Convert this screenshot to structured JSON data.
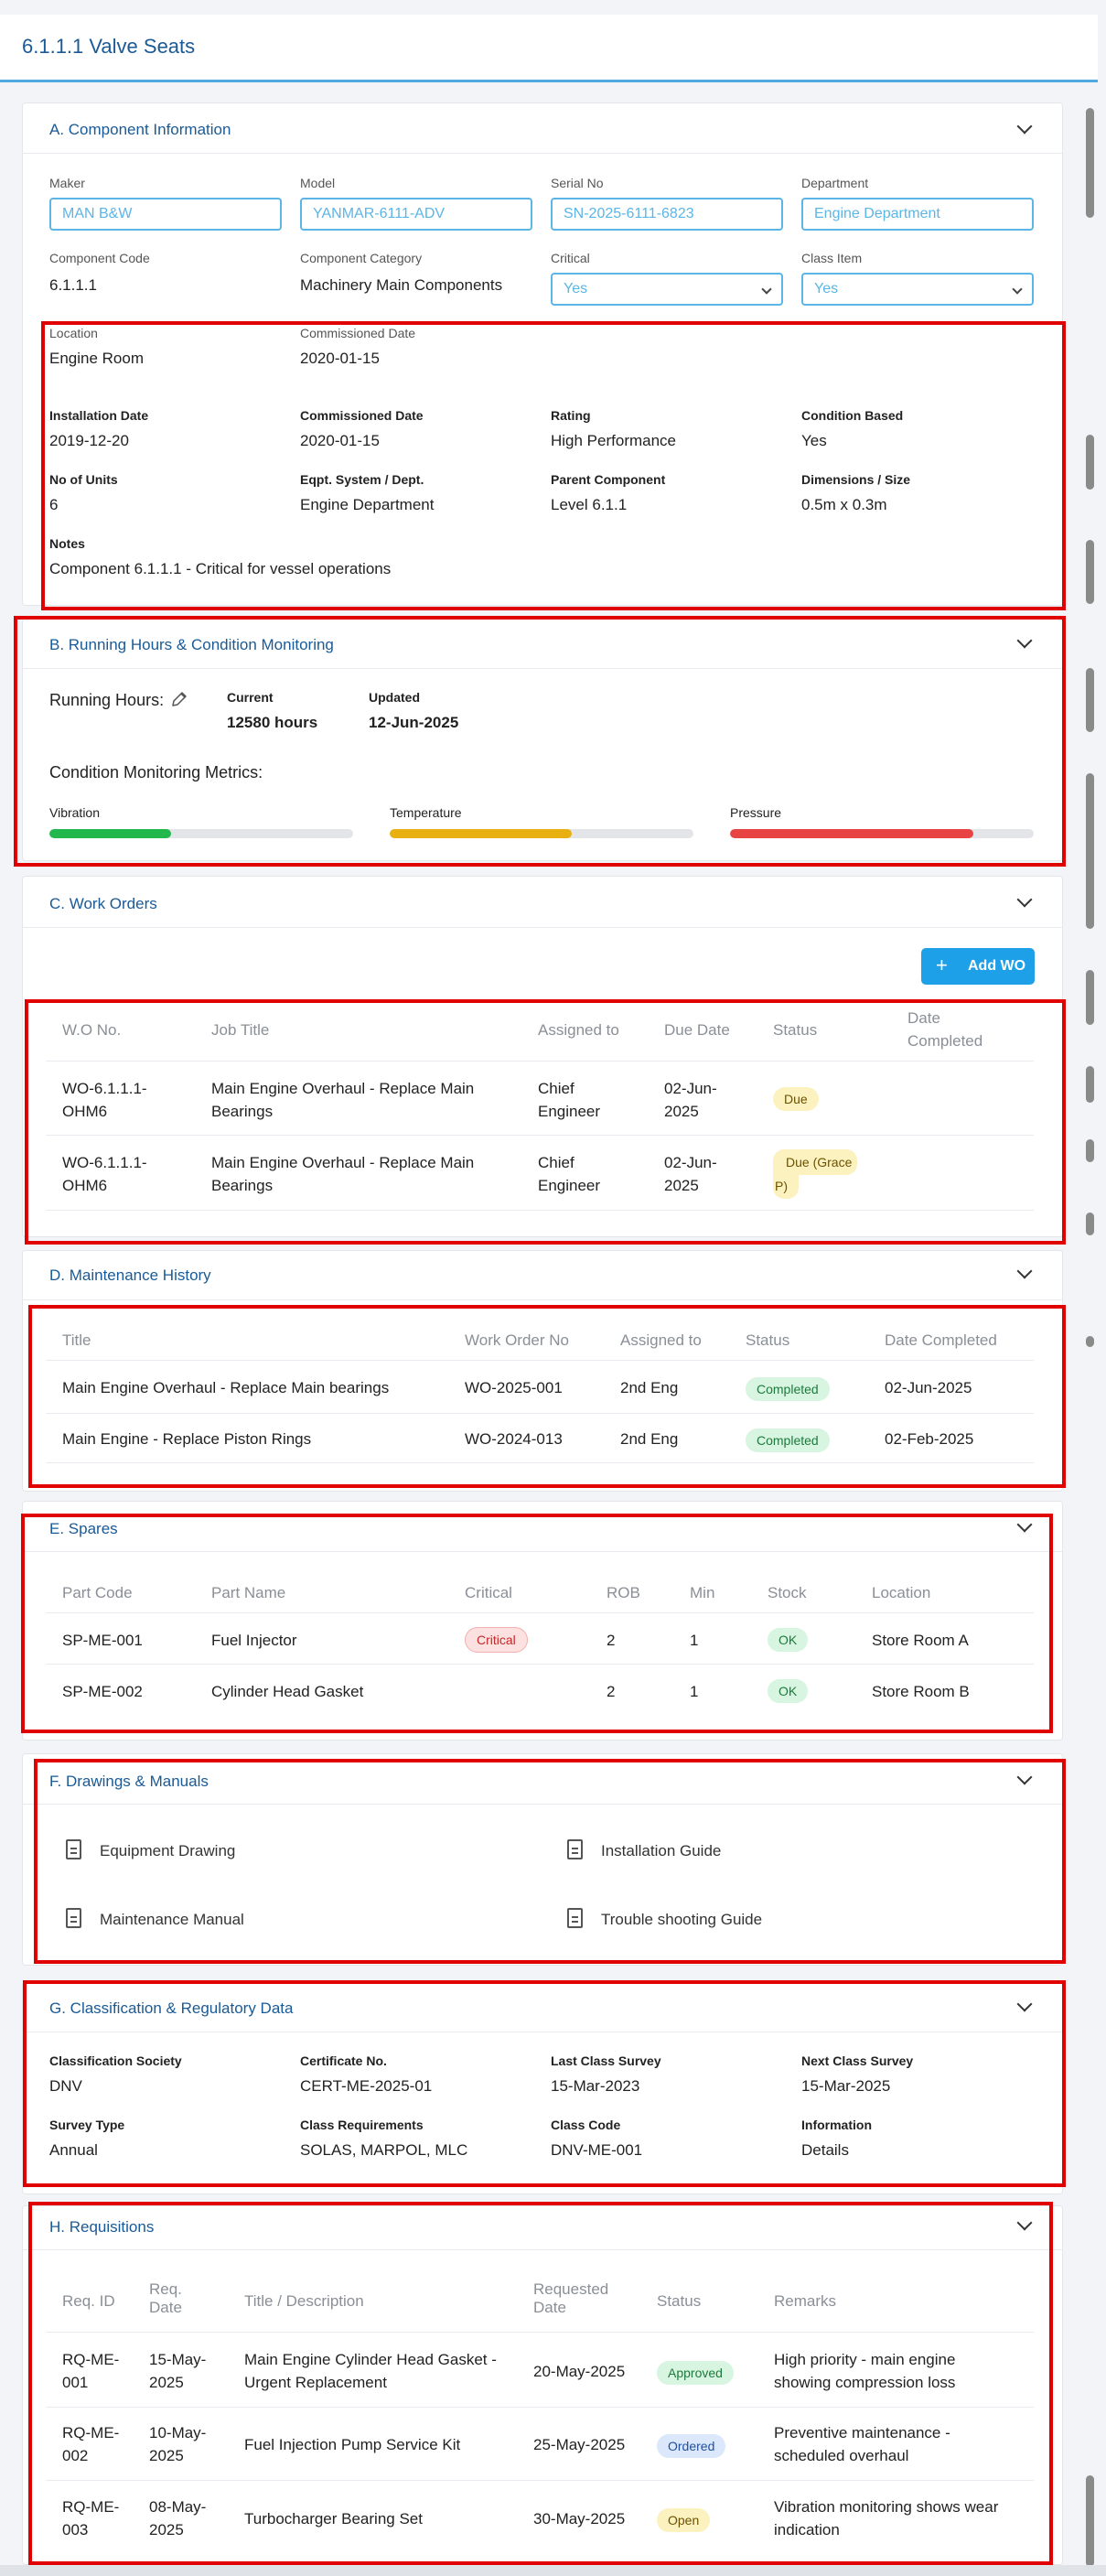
{
  "page_title": "6.1.1.1 Valve Seats",
  "sections": {
    "a": {
      "title": "A. Component Information",
      "maker_label": "Maker",
      "maker_value": "MAN B&W",
      "model_label": "Model",
      "model_value": "YANMAR-6111-ADV",
      "serial_label": "Serial No",
      "serial_value": "SN-2025-6111-6823",
      "dept_label": "Department",
      "dept_value": "Engine Department",
      "code_label": "Component Code",
      "code_value": "6.1.1.1",
      "category_label": "Component Category",
      "category_value": "Machinery Main Components",
      "critical_label": "Critical",
      "critical_value": "Yes",
      "class_label": "Class Item",
      "class_value": "Yes",
      "location_label": "Location",
      "location_value": "Engine Room",
      "commissioned_label": "Commissioned Date",
      "commissioned_value": "2020-01-15",
      "install_label": "Installation Date",
      "install_value": "2019-12-20",
      "commissioned2_label": "Commissioned Date",
      "commissioned2_value": "2020-01-15",
      "rating_label": "Rating",
      "rating_value": "High Performance",
      "condition_label": "Condition Based",
      "condition_value": "Yes",
      "units_label": "No of Units",
      "units_value": "6",
      "eqpt_label": "Eqpt. System / Dept.",
      "eqpt_value": "Engine Department",
      "parent_label": "Parent Component",
      "parent_value": "Level 6.1.1",
      "dims_label": "Dimensions / Size",
      "dims_value": "0.5m x 0.3m",
      "notes_label": "Notes",
      "notes_value": "Component 6.1.1.1 - Critical for vessel operations"
    },
    "b": {
      "title": "B. Running Hours & Condition Monitoring",
      "running_label": "Running Hours:",
      "current_label": "Current",
      "current_value": "12580 hours",
      "updated_label": "Updated",
      "updated_value": "12-Jun-2025",
      "metrics_label": "Condition Monitoring Metrics:",
      "metrics": [
        {
          "name": "Vibration",
          "level": 0.4,
          "color": "#22b84e"
        },
        {
          "name": "Temperature",
          "level": 0.6,
          "color": "#e8b010"
        },
        {
          "name": "Pressure",
          "level": 0.8,
          "color": "#e84444"
        }
      ]
    },
    "c": {
      "title": "C. Work Orders",
      "add_label": "Add WO",
      "headers": [
        "W.O No.",
        "Job Title",
        "Assigned to",
        "Due Date",
        "Status",
        "Date",
        "Completed"
      ],
      "rows": [
        {
          "wo1": "WO-6.1.1.1-",
          "wo2": "OHM6",
          "job1": "Main Engine Overhaul - Replace Main",
          "job2": "Bearings",
          "as1": "Chief",
          "as2": "Engineer",
          "due1": "02-Jun-",
          "due2": "2025",
          "status": "Due"
        },
        {
          "wo1": "WO-6.1.1.1-",
          "wo2": "OHM6",
          "job1": "Main Engine Overhaul - Replace Main",
          "job2": "Bearings",
          "as1": "Chief",
          "as2": "Engineer",
          "due1": "02-Jun-",
          "due2": "2025",
          "status1": "Due (Grace",
          "status2": "P)"
        }
      ]
    },
    "d": {
      "title": "D. Maintenance History",
      "headers": [
        "Title",
        "Work Order No",
        "Assigned to",
        "Status",
        "Date Completed"
      ],
      "rows": [
        {
          "title": "Main Engine Overhaul - Replace Main bearings",
          "wo": "WO-2025-001",
          "assigned": "2nd Eng",
          "status": "Completed",
          "date": "02-Jun-2025"
        },
        {
          "title": "Main Engine - Replace Piston Rings",
          "wo": "WO-2024-013",
          "assigned": "2nd Eng",
          "status": "Completed",
          "date": "02-Feb-2025"
        }
      ]
    },
    "e": {
      "title": "E. Spares",
      "headers": [
        "Part Code",
        "Part Name",
        "Critical",
        "ROB",
        "Min",
        "Stock",
        "Location"
      ],
      "rows": [
        {
          "code": "SP-ME-001",
          "name": "Fuel Injector",
          "critical": "Critical",
          "rob": "2",
          "min": "1",
          "stock": "OK",
          "location": "Store Room A"
        },
        {
          "code": "SP-ME-002",
          "name": "Cylinder Head Gasket",
          "critical": "",
          "rob": "2",
          "min": "1",
          "stock": "OK",
          "location": "Store Room B"
        }
      ]
    },
    "f": {
      "title": "F. Drawings & Manuals",
      "docs": [
        "Equipment Drawing",
        "Installation Guide",
        "Maintenance Manual",
        "Trouble shooting Guide"
      ]
    },
    "g": {
      "title": "G. Classification & Regulatory Data",
      "society_label": "Classification Society",
      "society_value": "DNV",
      "cert_label": "Certificate No.",
      "cert_value": "CERT-ME-2025-01",
      "last_label": "Last Class Survey",
      "last_value": "15-Mar-2023",
      "next_label": "Next Class Survey",
      "next_value": "15-Mar-2025",
      "survey_label": "Survey Type",
      "survey_value": "Annual",
      "req_label": "Class Requirements",
      "req_value": "SOLAS, MARPOL, MLC",
      "ccode_label": "Class Code",
      "ccode_value": "DNV-ME-001",
      "info_label": "Information",
      "info_value": "Details"
    },
    "h": {
      "title": "H. Requisitions",
      "headers": {
        "id": "Req. ID",
        "date1": "Req.",
        "date2": "Date",
        "title": "Title / Description",
        "req1": "Requested",
        "req2": "Date",
        "status": "Status",
        "remarks": "Remarks"
      },
      "rows": [
        {
          "id1": "RQ-ME-",
          "id2": "001",
          "d1": "15-May-",
          "d2": "2025",
          "t1": "Main Engine Cylinder Head Gasket -",
          "t2": "Urgent Replacement",
          "req": "20-May-2025",
          "status": "Approved",
          "r1": "High priority - main engine",
          "r2": "showing compression loss"
        },
        {
          "id1": "RQ-ME-",
          "id2": "002",
          "d1": "10-May-",
          "d2": "2025",
          "t1": "Fuel Injection Pump Service Kit",
          "t2": "",
          "req": "25-May-2025",
          "status": "Ordered",
          "r1": "Preventive maintenance -",
          "r2": "scheduled overhaul"
        },
        {
          "id1": "RQ-ME-",
          "id2": "003",
          "d1": "08-May-",
          "d2": "2025",
          "t1": "Turbocharger Bearing Set",
          "t2": "",
          "req": "30-May-2025",
          "status": "Open",
          "r1": "Vibration monitoring shows wear",
          "r2": "indication"
        }
      ]
    }
  }
}
